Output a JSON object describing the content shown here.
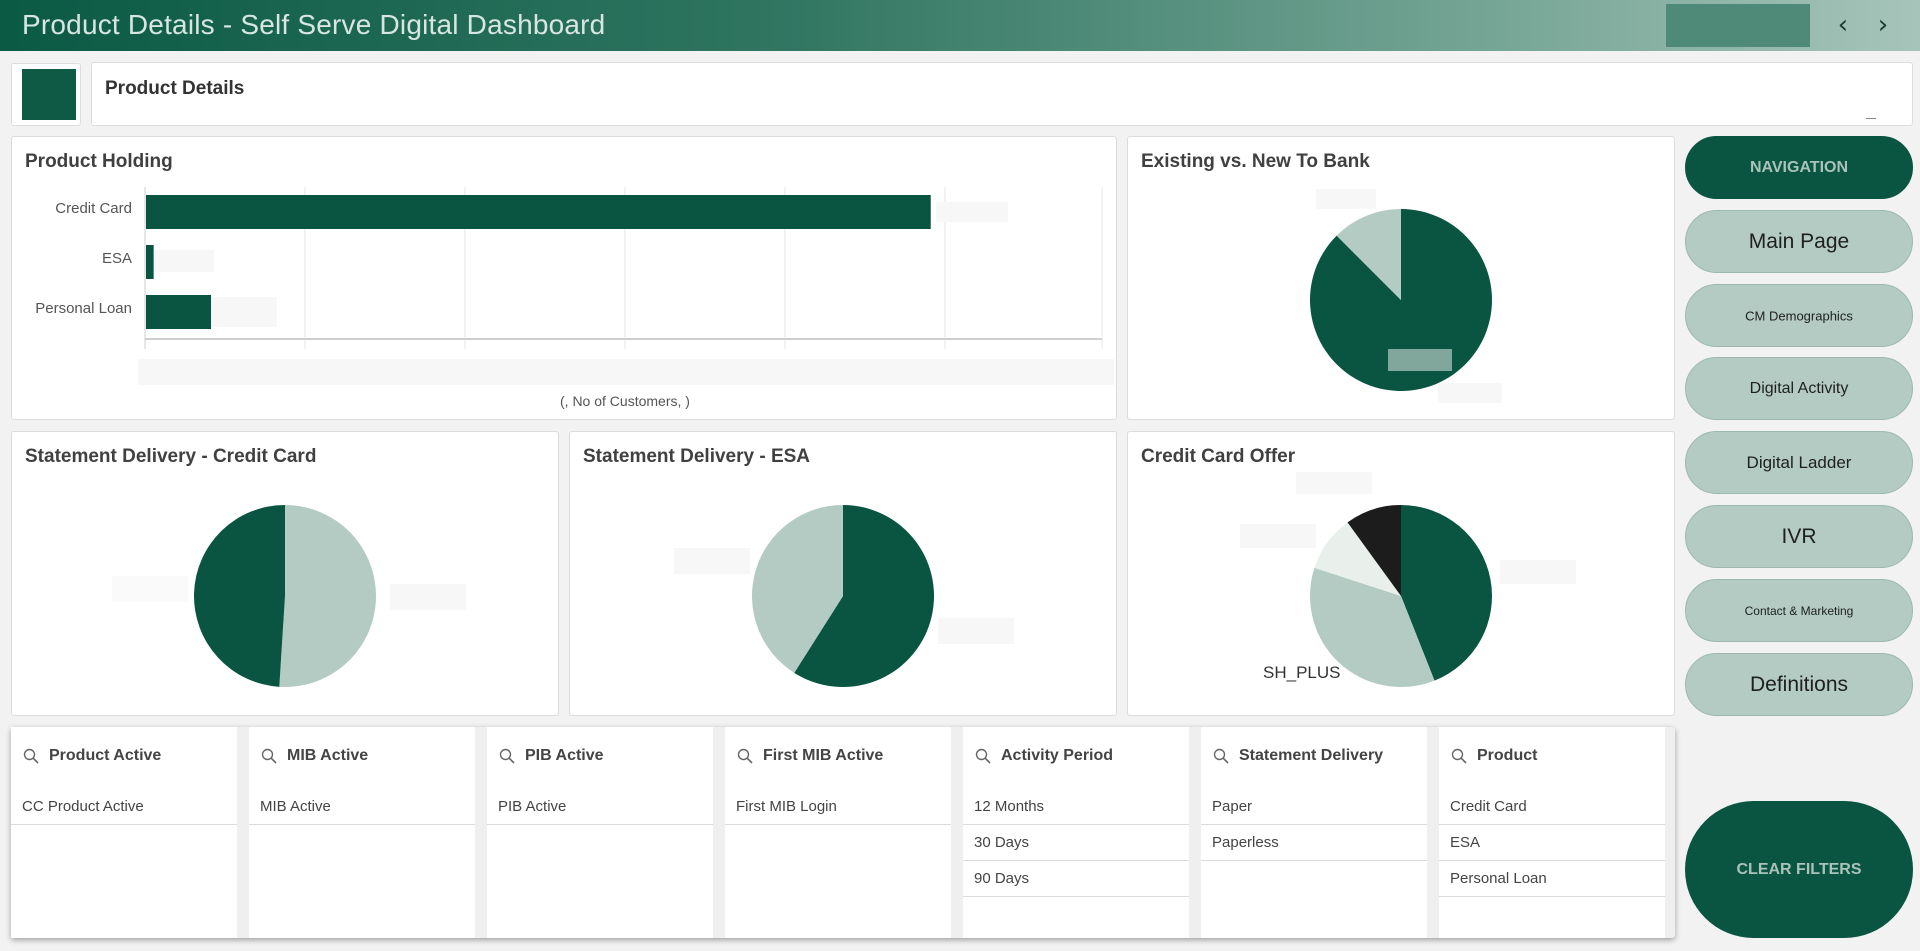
{
  "header": {
    "title": "Product Details - Self Serve Digital Dashboard",
    "prev_icon": "‹",
    "next_icon": "›"
  },
  "subheader": {
    "title": "Product Details",
    "minimize_glyph": "_"
  },
  "colors": {
    "brand": "#0a5541",
    "light": "#b3cbc2",
    "pale": "#e9f0ec",
    "black": "#1c1c1c"
  },
  "panels": {
    "holding": {
      "title": "Product Holding",
      "axis_title": "(, No of Customers, )"
    },
    "existing": {
      "title": "Existing vs. New To Bank"
    },
    "stmt_cc": {
      "title": "Statement Delivery - Credit Card"
    },
    "stmt_esa": {
      "title": "Statement Delivery - ESA"
    },
    "offer": {
      "title": "Credit Card Offer",
      "label": "SH_PLUS"
    }
  },
  "chart_data": [
    {
      "type": "bar",
      "orientation": "horizontal",
      "title": "Product Holding",
      "categories": [
        "Credit Card",
        "ESA",
        "Personal Loan"
      ],
      "values": [
        0.82,
        0.008,
        0.068
      ],
      "xlabel": "(, No of Customers, )",
      "grid": true
    },
    {
      "type": "pie",
      "title": "Existing vs. New To Bank",
      "values": [
        0.875,
        0.125
      ],
      "colors": [
        "#0a5541",
        "#b3cbc2"
      ]
    },
    {
      "type": "pie",
      "title": "Statement Delivery - Credit Card",
      "values": [
        0.51,
        0.49
      ],
      "colors": [
        "#b3cbc2",
        "#0a5541"
      ]
    },
    {
      "type": "pie",
      "title": "Statement Delivery - ESA",
      "values": [
        0.59,
        0.41
      ],
      "colors": [
        "#0a5541",
        "#b3cbc2"
      ]
    },
    {
      "type": "pie",
      "title": "Credit Card Offer",
      "values": [
        0.44,
        0.36,
        0.1,
        0.1
      ],
      "colors": [
        "#0a5541",
        "#b3cbc2",
        "#e9f0ec",
        "#1c1c1c"
      ]
    }
  ],
  "filters": [
    {
      "label": "Product Active",
      "items": [
        "CC Product Active"
      ]
    },
    {
      "label": "MIB Active",
      "items": [
        "MIB Active"
      ]
    },
    {
      "label": "PIB Active",
      "items": [
        "PIB Active"
      ]
    },
    {
      "label": "First MIB Active",
      "items": [
        "First MIB Login"
      ]
    },
    {
      "label": "Activity Period",
      "items": [
        "12 Months",
        "30 Days",
        "90 Days"
      ]
    },
    {
      "label": "Statement Delivery",
      "items": [
        "Paper",
        "Paperless"
      ]
    },
    {
      "label": "Product",
      "items": [
        "Credit Card",
        "ESA",
        "Personal Loan"
      ]
    }
  ],
  "nav": {
    "header": "NAVIGATION",
    "items": [
      "Main Page",
      "CM Demographics",
      "Digital Activity",
      "Digital Ladder",
      "IVR",
      "Contact & Marketing",
      "Definitions"
    ],
    "clear": "CLEAR FILTERS"
  }
}
